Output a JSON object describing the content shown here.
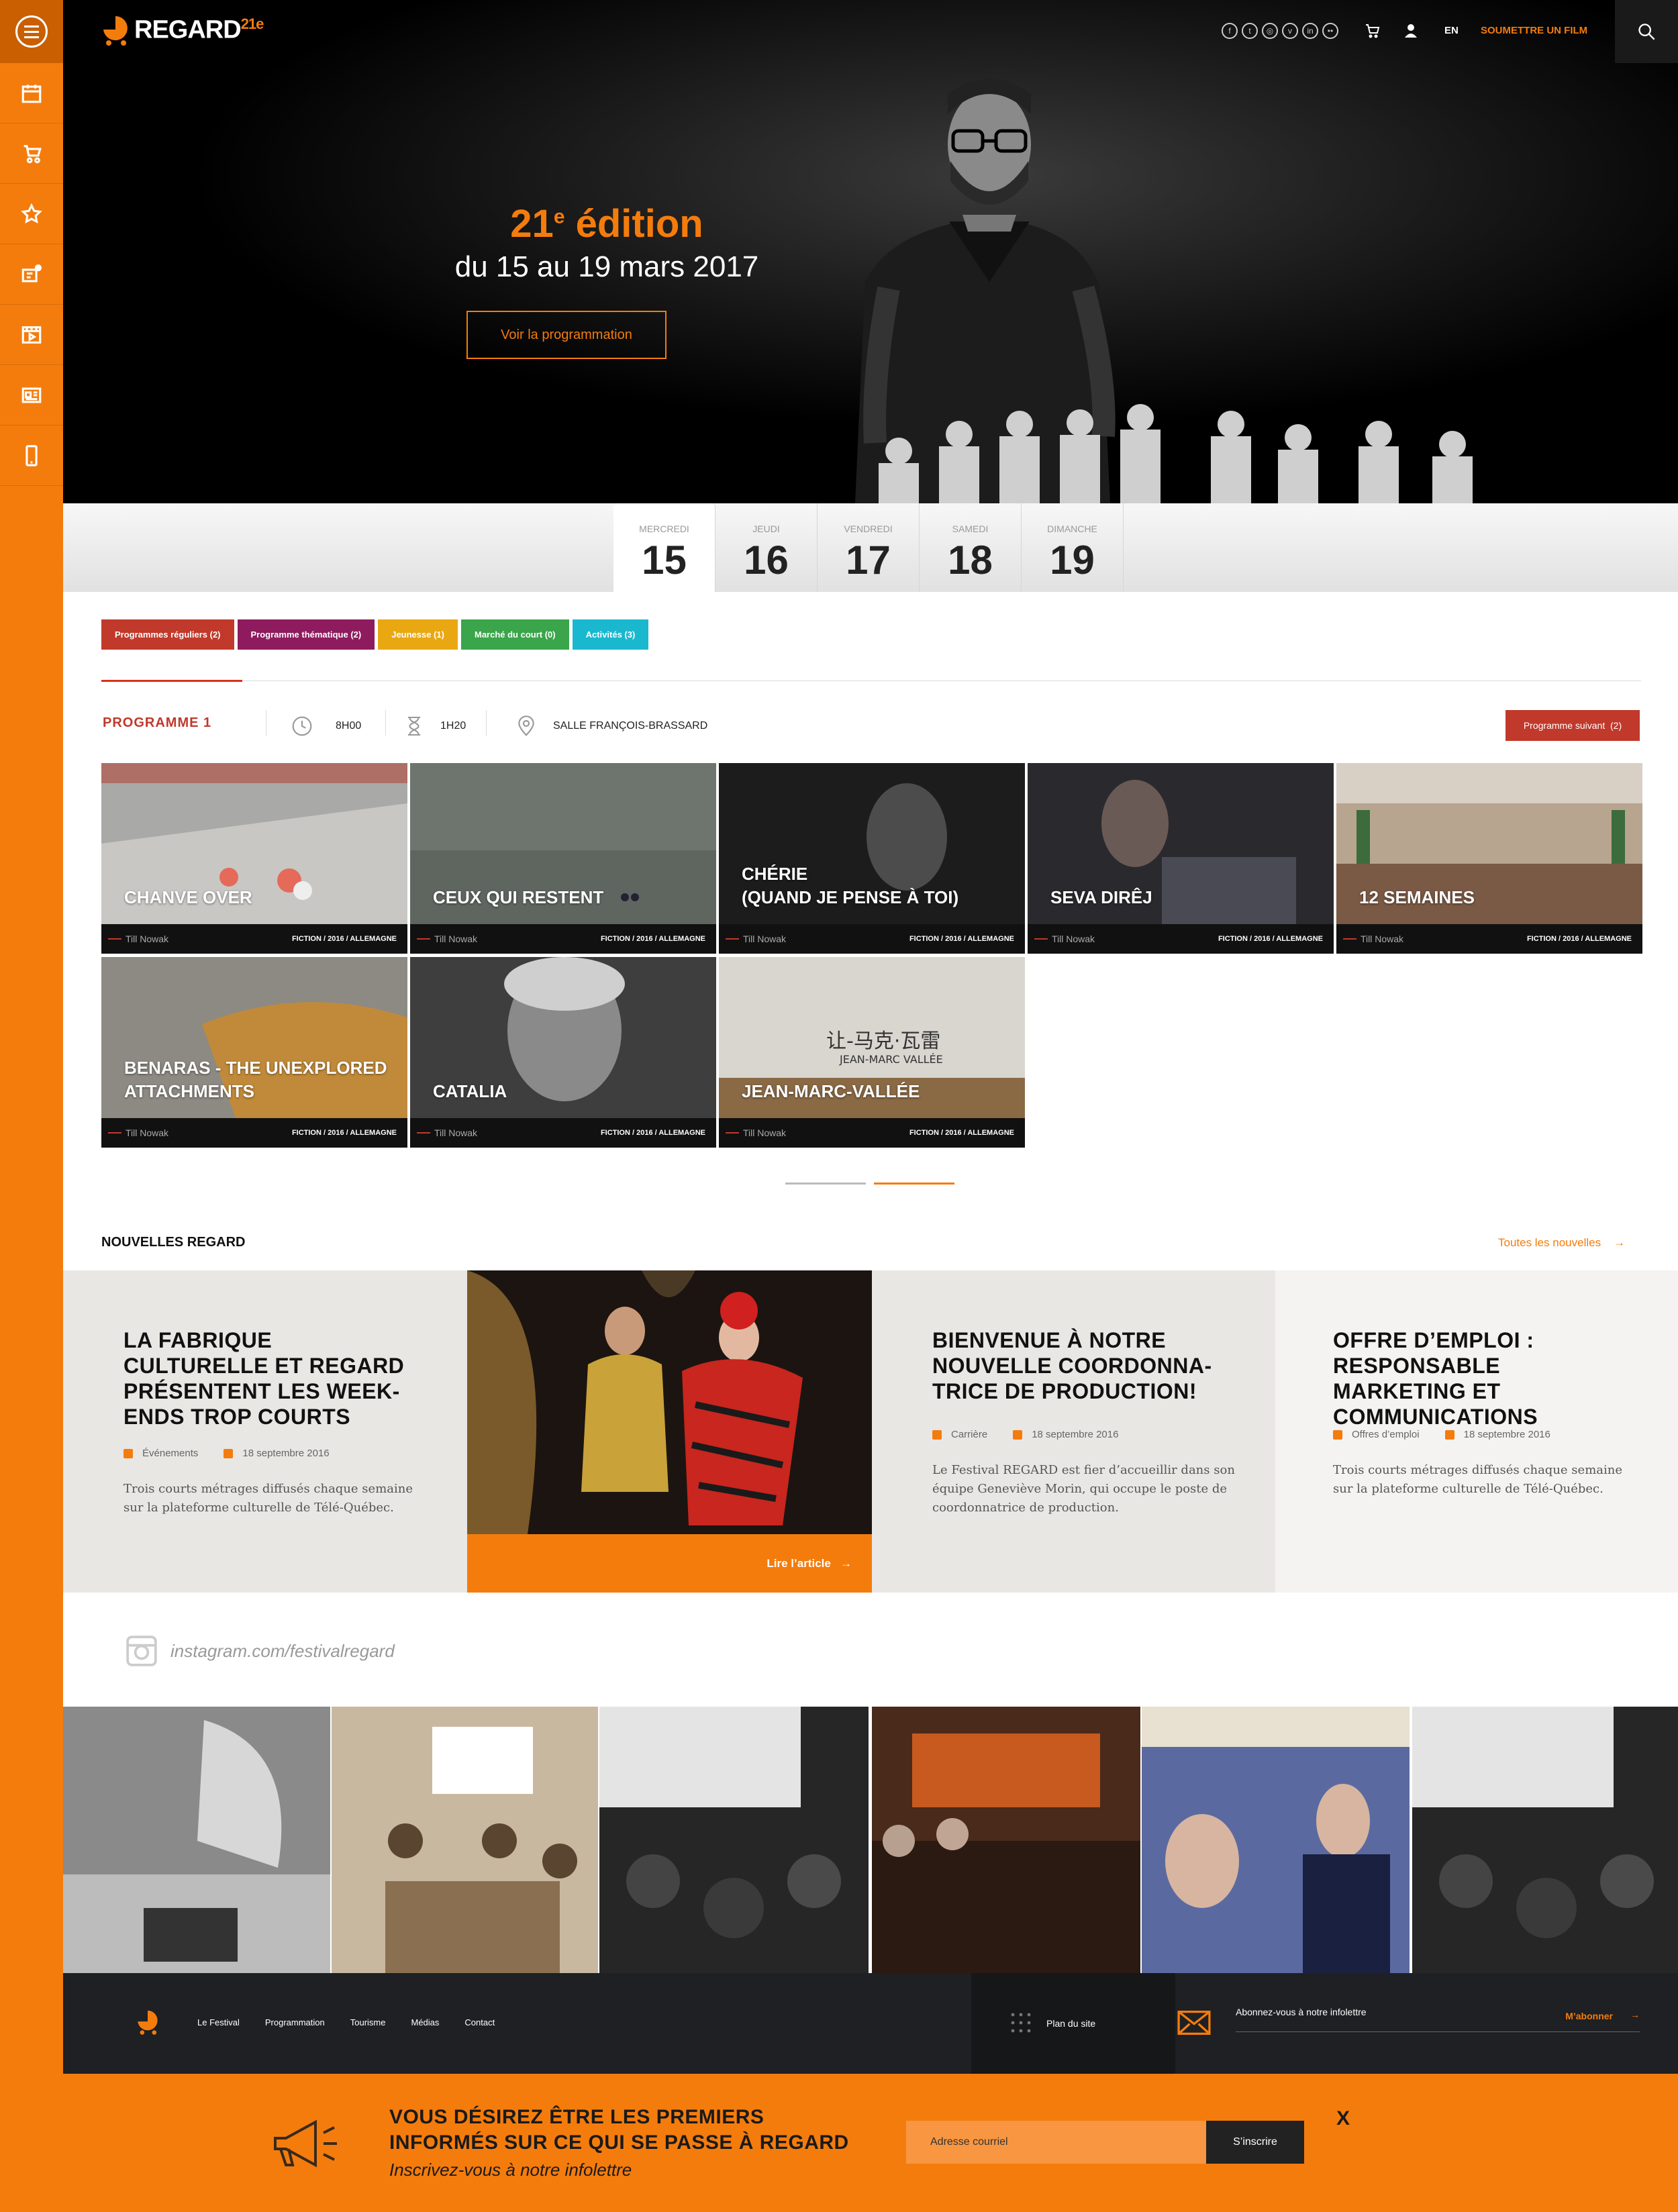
{
  "header": {
    "logo_text": "REGARD",
    "logo_edition": "21e",
    "social_icons": [
      "facebook-icon",
      "twitter-icon",
      "instagram-icon",
      "vimeo-icon",
      "linkedin-icon",
      "flickr-icon"
    ],
    "lang": "EN",
    "submit_label": "SOUMETTRE UN FILM"
  },
  "hero": {
    "edition": "21",
    "edition_sup": "e",
    "edition_word": " édition",
    "dates": "du 15 au 19 mars 2017",
    "cta": "Voir la programmation"
  },
  "days": [
    {
      "name": "Mercredi",
      "num": "15",
      "active": true
    },
    {
      "name": "Jeudi",
      "num": "16"
    },
    {
      "name": "Vendredi",
      "num": "17"
    },
    {
      "name": "Samedi",
      "num": "18"
    },
    {
      "name": "Dimanche",
      "num": "19"
    }
  ],
  "filters": [
    {
      "label": "Programmes réguliers (2)",
      "color": "#c0392b"
    },
    {
      "label": "Programme thématique (2)",
      "color": "#8e1b5e"
    },
    {
      "label": "Jeunesse (1)",
      "color": "#e9a812"
    },
    {
      "label": "Marché du court (0)",
      "color": "#3aa54a"
    },
    {
      "label": "Activités (3)",
      "color": "#19b8cf"
    }
  ],
  "program": {
    "title": "PROGRAMME 1",
    "time": "8H00",
    "duration": "1H20",
    "venue": "SALLE FRANÇOIS-BRASSARD",
    "next_label": "Programme suivant",
    "next_count": "(2)"
  },
  "films": [
    {
      "title": "CHANVE OVER",
      "director": "Till Nowak",
      "info": "FICTION  /  2016  /  ALLEMAGNE"
    },
    {
      "title": "CEUX QUI RESTENT",
      "director": "Till Nowak",
      "info": "FICTION  /  2016  /  ALLEMAGNE"
    },
    {
      "title": "CHÉRIE\n(QUAND JE PENSE À TOI)",
      "director": "Till Nowak",
      "info": "FICTION  /  2016  /  ALLEMAGNE"
    },
    {
      "title": "SEVA DIRÊJ",
      "director": "Till Nowak",
      "info": "FICTION  /  2016  /  ALLEMAGNE"
    },
    {
      "title": "12 SEMAINES",
      "director": "Till Nowak",
      "info": "FICTION  /  2016  /  ALLEMAGNE"
    },
    {
      "title": "BENARAS - THE UNEXPLORED\nATTACHMENTS",
      "director": "Till Nowak",
      "info": "FICTION  /  2016  /  ALLEMAGNE"
    },
    {
      "title": "CATALIA",
      "director": "Till Nowak",
      "info": "FICTION  /  2016  /  ALLEMAGNE"
    },
    {
      "title": "JEAN-MARC-VALLÉE",
      "director": "Till Nowak",
      "info": "FICTION  /  2016  /  ALLEMAGNE"
    }
  ],
  "news": {
    "heading": "NOUVELLES REGARD",
    "all_label": "Toutes les nouvelles",
    "items": [
      {
        "title": "LA FABRIQUE CULTURELLE ET REGARD PRÉSENTENT LES WEEK-ENDS TROP COURTS",
        "category": "Événements",
        "date": "18 septembre 2016",
        "excerpt": "Trois courts métrages diffusés chaque semaine sur la plateforme culturelle de Télé-Québec."
      },
      {
        "title": "BIENVENUE À NOTRE NOUVELLE COORDONNA-TRICE DE PRODUCTION!",
        "category": "Carrière",
        "date": "18 septembre 2016",
        "excerpt": "Le Festival REGARD est fier d’accueillir dans son équipe Geneviève Morin, qui occupe le poste de coordonnatrice de production."
      },
      {
        "title": "OFFRE D’EMPLOI : RESPONSABLE MARKETING ET COMMUNICATIONS",
        "category": "Offres d’emploi",
        "date": "18 septembre 2016",
        "excerpt": "Trois courts métrages diffusés chaque semaine sur la plateforme culturelle de Télé-Québec."
      }
    ],
    "read_more": "Lire l’article"
  },
  "instagram": {
    "handle": "instagram.com/festivalregard"
  },
  "footer": {
    "nav": [
      "Le Festival",
      "Programmation",
      "Tourisme",
      "Médias",
      "Contact"
    ],
    "sitemap": "Plan du site",
    "newsletter_label": "Abonnez-vous à notre infolettre",
    "subscribe": "M’abonner"
  },
  "banner": {
    "headline_1": "VOUS DÉSIREZ ÊTRE LES PREMIERS",
    "headline_2": "INFORMÉS SUR CE QUI SE PASSE À REGARD",
    "sub": "Inscrivez-vous à notre infolettre",
    "input_placeholder": "Adresse courriel",
    "button": "S’inscrire",
    "close": "X"
  },
  "colors": {
    "accent": "#f47c0d",
    "dark": "#000000",
    "program_red": "#c0392b"
  }
}
